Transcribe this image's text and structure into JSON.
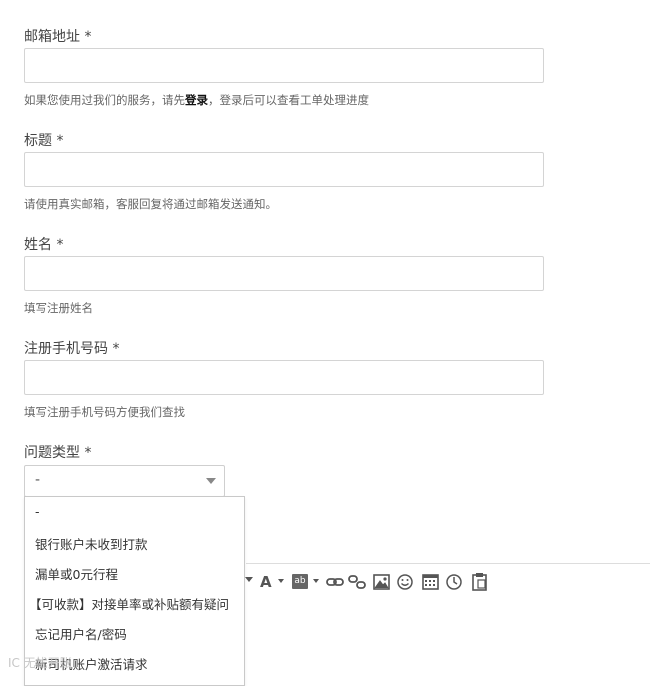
{
  "form": {
    "email": {
      "label": "邮箱地址 *",
      "help_prefix": "如果您使用过我们的服务，请先",
      "help_link": "登录",
      "help_suffix": "，登录后可以查看工单处理进度"
    },
    "title": {
      "label": "标题 *",
      "help": "请使用真实邮箱，客服回复将通过邮箱发送通知。"
    },
    "name": {
      "label": "姓名 *",
      "help": "填写注册姓名"
    },
    "phone": {
      "label": "注册手机号码 *",
      "help": "填写注册手机号码方便我们查找"
    },
    "issue_type": {
      "label": "问题类型 *",
      "selected": "-",
      "options": [
        "-",
        "银行账户未收到打款",
        "漏单或0元行程",
        "【可收款】对接单率或补贴额有疑问",
        "忘记用户名/密码",
        "新司机账户激活请求"
      ]
    }
  },
  "toolbar": {
    "font_color_glyph": "A",
    "highlight_glyph": "ab"
  },
  "watermark": "IC 无忧开账"
}
